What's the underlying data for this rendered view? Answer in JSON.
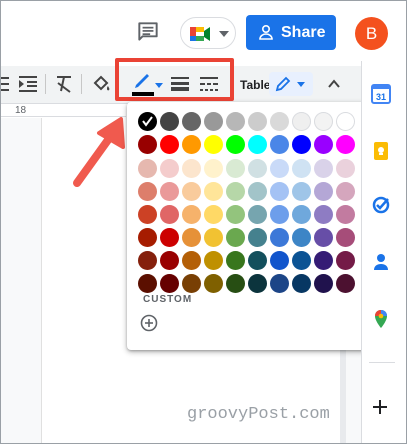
{
  "header": {
    "share_label": "Share",
    "avatar_initial": "B",
    "icons": [
      "comment-icon",
      "meet-icon",
      "lock-icon"
    ]
  },
  "toolbar": {
    "table_label": "Table",
    "ruler_number": "18",
    "icons": [
      "line-spacing-icon",
      "indent-icon",
      "clear-formatting-icon",
      "fill-color-icon",
      "border-color-icon",
      "border-width-icon",
      "border-dash-icon",
      "pen-icon",
      "chevron-up-icon"
    ],
    "border_color_current": "#000000",
    "highlight_color": "#ea4335"
  },
  "palette": {
    "selected": "#000000",
    "colors": [
      [
        "#000000",
        "#434343",
        "#666666",
        "#999999",
        "#b7b7b7",
        "#cccccc",
        "#d9d9d9",
        "#efefef",
        "#f3f3f3",
        "#ffffff"
      ],
      [
        "#980000",
        "#ff0000",
        "#ff9900",
        "#ffff00",
        "#00ff00",
        "#00ffff",
        "#4a86e8",
        "#0000ff",
        "#9900ff",
        "#ff00ff"
      ],
      [
        "#e6b8af",
        "#f4cccc",
        "#fce5cd",
        "#fff2cc",
        "#d9ead3",
        "#d0e0e3",
        "#c9daf8",
        "#cfe2f3",
        "#d9d2e9",
        "#ead1dc"
      ],
      [
        "#dd7e6b",
        "#ea9999",
        "#f9cb9c",
        "#ffe599",
        "#b6d7a8",
        "#a2c4c9",
        "#a4c2f4",
        "#9fc5e8",
        "#b4a7d6",
        "#d5a6bd"
      ],
      [
        "#cc4125",
        "#e06666",
        "#f6b26b",
        "#ffd966",
        "#93c47d",
        "#76a5af",
        "#6d9eeb",
        "#6fa8dc",
        "#8e7cc3",
        "#c27ba0"
      ],
      [
        "#a61c00",
        "#cc0000",
        "#e69138",
        "#f1c232",
        "#6aa84f",
        "#45818e",
        "#3c78d8",
        "#3d85c6",
        "#674ea7",
        "#a64d79"
      ],
      [
        "#85200c",
        "#990000",
        "#b45f06",
        "#bf9000",
        "#38761d",
        "#134f5c",
        "#1155cc",
        "#0b5394",
        "#351c75",
        "#741b47"
      ],
      [
        "#5b0f00",
        "#660000",
        "#783f04",
        "#7f6000",
        "#274e13",
        "#0c343d",
        "#1c4587",
        "#073763",
        "#20124d",
        "#4c1130"
      ]
    ],
    "custom_label": "CUSTOM"
  },
  "side_panel": {
    "icons": [
      "calendar-icon",
      "keep-icon",
      "tasks-icon",
      "contacts-icon",
      "maps-icon",
      "add-icon"
    ],
    "calendar_day": "31"
  },
  "watermark": "groovyPost.com"
}
